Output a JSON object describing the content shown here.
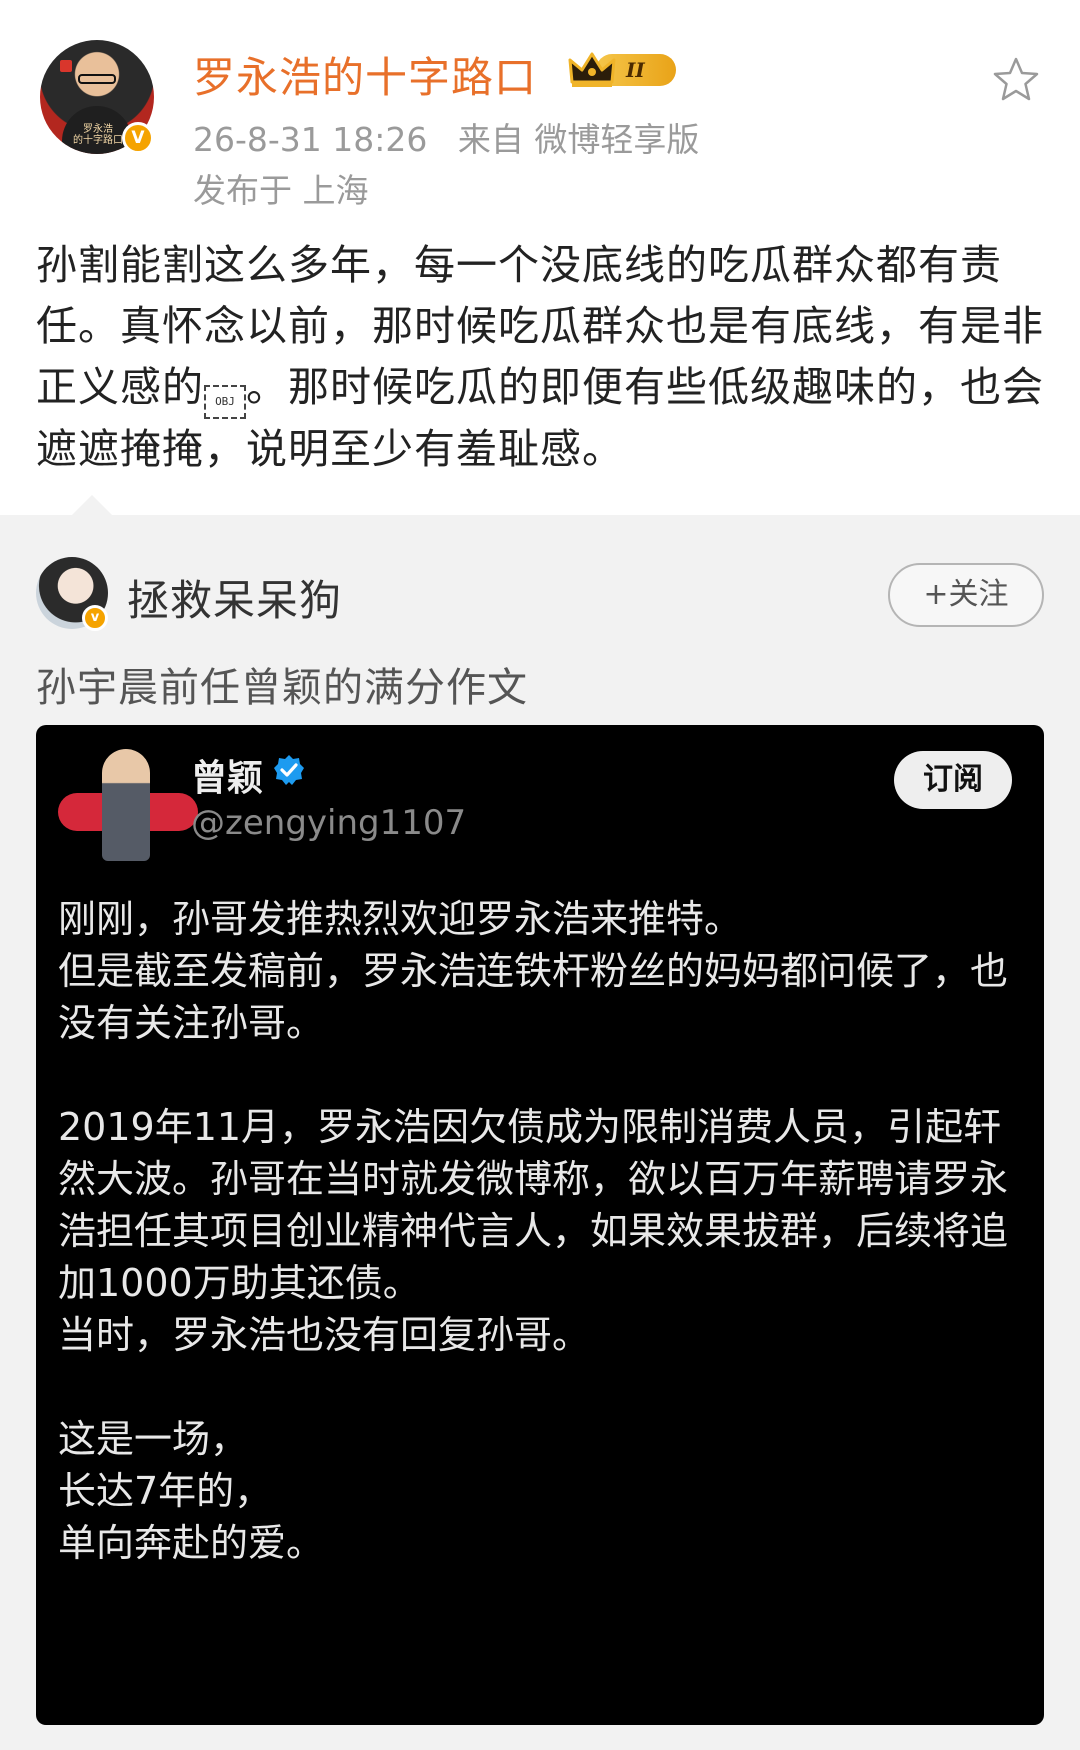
{
  "post": {
    "author": "罗永浩的十字路口",
    "avatar_caption": "罗永浩\n的十字路口",
    "verified_mark": "V",
    "level_badge": "II",
    "time": "26-8-31 18:26",
    "source": "来自 微博轻享版",
    "location": "发布于 上海",
    "text_before_obj": "孙割能割这么多年，每一个没底线的吃瓜群众都有责任。真怀念以前，那时候吃瓜群众也是有底线，有是非正义感的",
    "obj_glyph": "OBJ",
    "text_after_obj": "。那时候吃瓜的即便有些低级趣味的，也会遮遮掩掩，说明至少有羞耻感。"
  },
  "repost": {
    "author": "拯救呆呆狗",
    "verified_mark": "v",
    "follow_label": "+关注",
    "text": "孙宇晨前任曾颖的满分作文",
    "tweet": {
      "name": "曾颖",
      "handle": "@zengying1107",
      "subscribe_label": "订阅",
      "paragraphs": [
        "刚刚，孙哥发推热烈欢迎罗永浩来推特。\n但是截至发稿前，罗永浩连铁杆粉丝的妈妈都问候了，也没有关注孙哥。",
        "2019年11月，罗永浩因欠债成为限制消费人员，引起轩然大波。孙哥在当时就发微博称，欲以百万年薪聘请罗永浩担任其项目创业精神代言人，如果效果拔群，后续将追加1000万助其还债。\n当时，罗永浩也没有回复孙哥。",
        "这是一场，\n长达7年的，\n单向奔赴的爱。"
      ]
    }
  },
  "colors": {
    "author_name": "#e8702a",
    "verified_badge": "#f5a300",
    "twitter_verified": "#1d9bf0",
    "tweet_background": "#000000",
    "repost_background": "#f2f2f2"
  }
}
